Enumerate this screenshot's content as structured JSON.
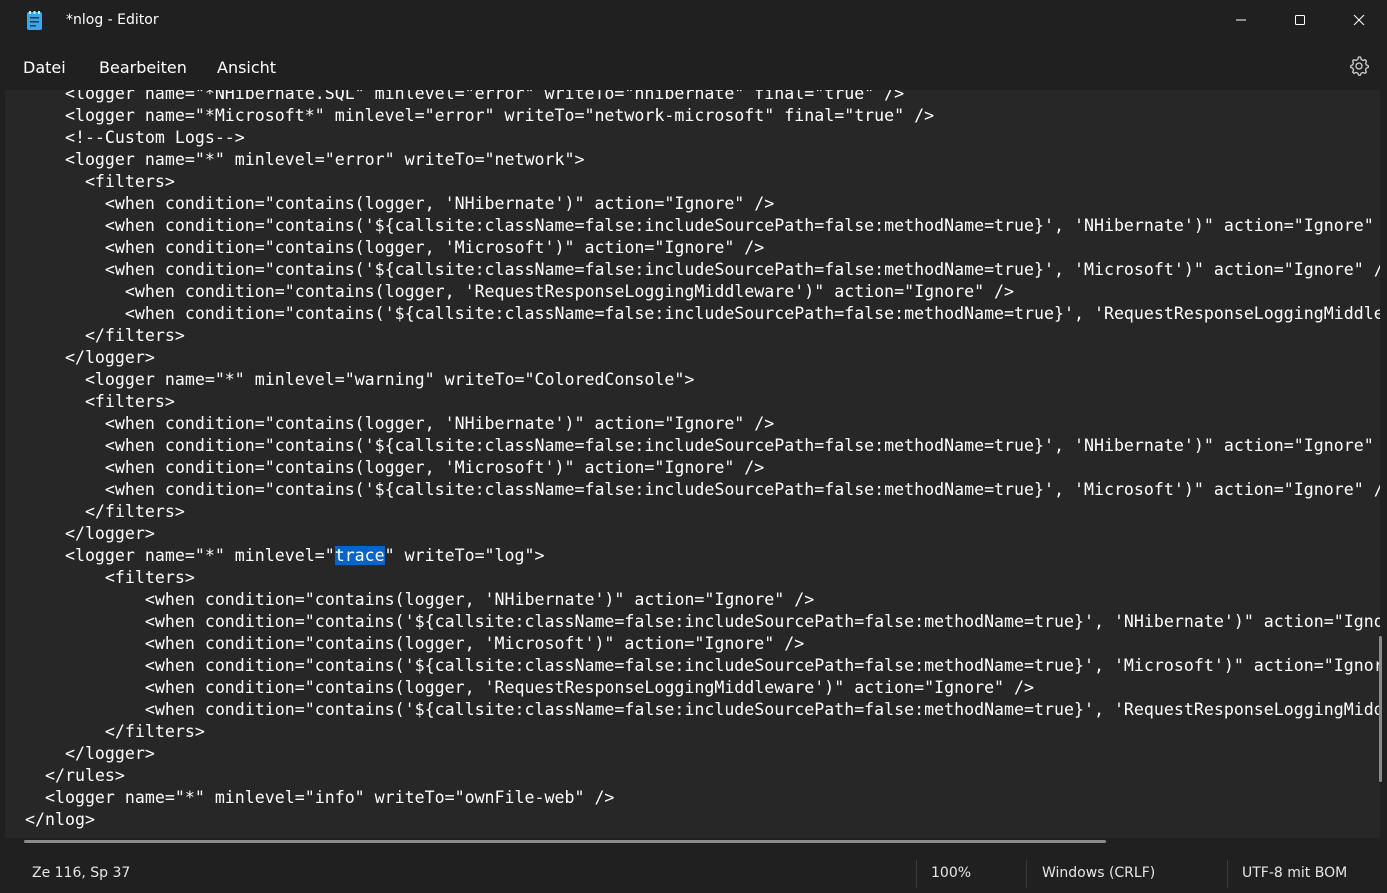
{
  "window": {
    "title": "*nlog - Editor",
    "icon": "notepad-icon"
  },
  "menu": {
    "items": [
      "Datei",
      "Bearbeiten",
      "Ansicht"
    ]
  },
  "editor": {
    "lines": [
      "    <logger name=\"*NHibernate.SQL\" minlevel=\"error\" writeTo=\"nhibernate\" final=\"true\" />",
      "    <logger name=\"*Microsoft*\" minlevel=\"error\" writeTo=\"network-microsoft\" final=\"true\" />",
      "    <!--Custom Logs-->",
      "    <logger name=\"*\" minlevel=\"error\" writeTo=\"network\">",
      "      <filters>",
      "        <when condition=\"contains(logger, 'NHibernate')\" action=\"Ignore\" />",
      "        <when condition=\"contains('${callsite:className=false:includeSourcePath=false:methodName=true}', 'NHibernate')\" action=\"Ignore\" />",
      "        <when condition=\"contains(logger, 'Microsoft')\" action=\"Ignore\" />",
      "        <when condition=\"contains('${callsite:className=false:includeSourcePath=false:methodName=true}', 'Microsoft')\" action=\"Ignore\" />",
      "          <when condition=\"contains(logger, 'RequestResponseLoggingMiddleware')\" action=\"Ignore\" />",
      "          <when condition=\"contains('${callsite:className=false:includeSourcePath=false:methodName=true}', 'RequestResponseLoggingMiddleware')\" action=\"Ignore\" />",
      "      </filters>",
      "    </logger>",
      "      <logger name=\"*\" minlevel=\"warning\" writeTo=\"ColoredConsole\">",
      "      <filters>",
      "        <when condition=\"contains(logger, 'NHibernate')\" action=\"Ignore\" />",
      "        <when condition=\"contains('${callsite:className=false:includeSourcePath=false:methodName=true}', 'NHibernate')\" action=\"Ignore\" />",
      "        <when condition=\"contains(logger, 'Microsoft')\" action=\"Ignore\" />",
      "        <when condition=\"contains('${callsite:className=false:includeSourcePath=false:methodName=true}', 'Microsoft')\" action=\"Ignore\" />",
      "      </filters>",
      "    </logger>",
      "    <logger name=\"*\" minlevel=\"trace\" writeTo=\"log\">",
      "        <filters>",
      "            <when condition=\"contains(logger, 'NHibernate')\" action=\"Ignore\" />",
      "            <when condition=\"contains('${callsite:className=false:includeSourcePath=false:methodName=true}', 'NHibernate')\" action=\"Ignore\" />",
      "            <when condition=\"contains(logger, 'Microsoft')\" action=\"Ignore\" />",
      "            <when condition=\"contains('${callsite:className=false:includeSourcePath=false:methodName=true}', 'Microsoft')\" action=\"Ignore\" />",
      "            <when condition=\"contains(logger, 'RequestResponseLoggingMiddleware')\" action=\"Ignore\" />",
      "            <when condition=\"contains('${callsite:className=false:includeSourcePath=false:methodName=true}', 'RequestResponseLoggingMiddleware')\" action=\"Ignore\" />",
      "        </filters>",
      "    </logger>",
      "  </rules>",
      "  <logger name=\"*\" minlevel=\"info\" writeTo=\"ownFile-web\" />",
      "</nlog>"
    ],
    "selection": {
      "line_index": 21,
      "text": "trace"
    }
  },
  "status": {
    "position": "Ze 116, Sp 37",
    "zoom": "100%",
    "line_ending": "Windows (CRLF)",
    "encoding": "UTF-8 mit BOM"
  },
  "colors": {
    "background": "#202020",
    "editor_background": "#272727",
    "selection": "#0a64c8",
    "text": "#ffffff"
  }
}
